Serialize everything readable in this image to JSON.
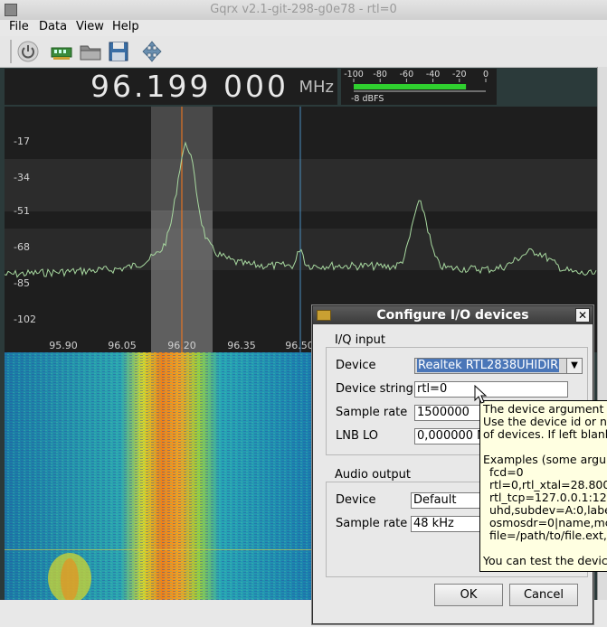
{
  "window": {
    "title": "Gqrx v2.1-git-298-g0e78 - rtl=0"
  },
  "menu": [
    "File",
    "Data",
    "View",
    "Help"
  ],
  "toolbar": {
    "icons": [
      "power-icon",
      "device-icon",
      "folder-icon",
      "save-icon",
      "resize-icon"
    ]
  },
  "frequency": {
    "value": "96.199 000",
    "unit": "MHz"
  },
  "meter": {
    "scale": [
      "-100",
      "-80",
      "-60",
      "-40",
      "-20",
      "0"
    ],
    "readout": "-8 dBFS",
    "level_fraction": 0.85
  },
  "spectrum": {
    "y_ticks": [
      "-17",
      "-34",
      "-51",
      "-68",
      "-85",
      "-102"
    ],
    "x_ticks": [
      "95.90",
      "96.05",
      "96.20",
      "96.35",
      "96.50"
    ]
  },
  "dialog": {
    "title": "Configure I/O devices",
    "iq_group": "I/Q input",
    "device_label": "Device",
    "device_value": "Realtek RTL2838UHIDIR",
    "device_string_label": "Device string",
    "device_string_value": "rtl=0",
    "sample_rate_label": "Sample rate",
    "sample_rate_value": "1500000",
    "lnb_label": "LNB LO",
    "lnb_value": "0,000000 M",
    "audio_group": "Audio output",
    "audio_device_label": "Device",
    "audio_device_value": "Default",
    "audio_rate_label": "Sample rate",
    "audio_rate_value": "48 kHz",
    "ok": "OK",
    "cancel": "Cancel"
  },
  "tooltip": {
    "lines": [
      "The device argument i",
      "Use the device id or n",
      "of devices. If left blank",
      "",
      "Examples (some argum",
      "  fcd=0",
      "  rtl=0,rtl_xtal=28.800",
      "  rtl_tcp=127.0.0.1:12",
      "  uhd,subdev=A:0,labe",
      "  osmosdr=0|name,mc",
      "  file=/path/to/file.ext,f",
      "",
      "You can test the devic"
    ]
  },
  "colors": {
    "spectrum_bg": "#1e1e1e",
    "trace": "#a8d9a0",
    "center_line": "#ff7a1a",
    "tooltip_bg": "#ffffe1",
    "meter_bar": "#2fd02f"
  }
}
